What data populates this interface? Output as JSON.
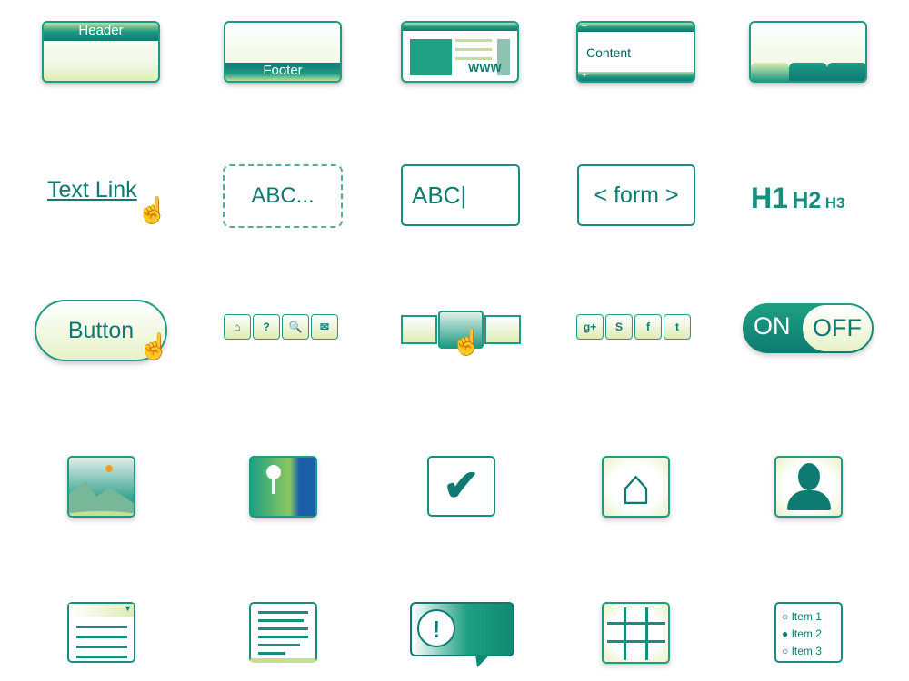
{
  "colors": {
    "primary": "#0e7a72",
    "accent": "#1f9a84",
    "light": "#e6f2c8"
  },
  "row1": {
    "header": "Header",
    "footer": "Footer",
    "www": "WWW",
    "content": "Content",
    "minus": "−",
    "plus": "+"
  },
  "row2": {
    "text_link": "Text Link",
    "placeholder": "ABC...",
    "input_value": "ABC",
    "form": "< form >",
    "h1": "H1",
    "h2": "H2",
    "h3": "H3"
  },
  "row3": {
    "button": "Button",
    "toolbar": [
      "⌂",
      "?",
      "🔍",
      "✉"
    ],
    "social": [
      "g+",
      "S",
      "f",
      "t"
    ],
    "toggle_on": "ON",
    "toggle_off": "OFF",
    "hand": "☝"
  },
  "row5": {
    "alert": "!",
    "radio_items": [
      "Item 1",
      "Item 2",
      "Item 3"
    ],
    "dropdown_arrow": "▼"
  }
}
